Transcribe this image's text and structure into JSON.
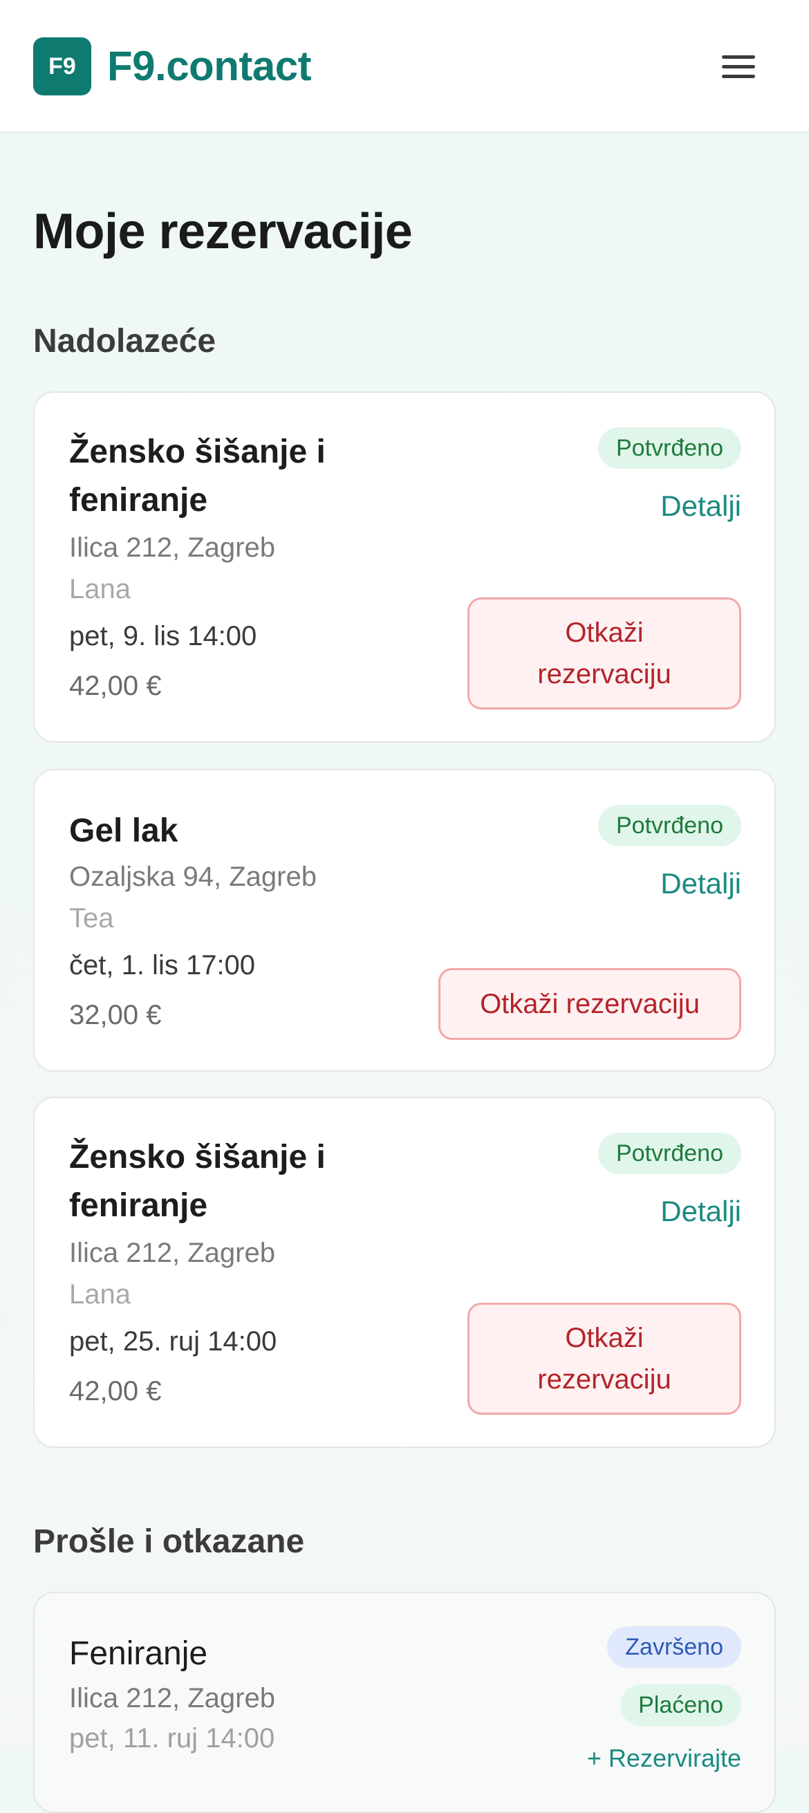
{
  "header": {
    "logo_text": "F9",
    "brand": "F9.contact",
    "menu_icon": "hamburger-icon"
  },
  "page_title": "Moje rezervacije",
  "sections": {
    "upcoming_title": "Nadolazeće",
    "past_title": "Prošle i otkazane"
  },
  "upcoming": [
    {
      "service_line1": "Žensko šišanje i",
      "service_line2": "feniranje",
      "address": "Ilica 212, Zagreb",
      "staff": "Lana",
      "datetime": "pet, 9. lis 14:00",
      "price": "42,00 €",
      "status": "Potvrđeno",
      "details_label": "Detalji",
      "cancel_line1": "Otkaži",
      "cancel_line2": "rezervaciju"
    },
    {
      "service_line1": "Gel lak",
      "address": "Ozaljska 94, Zagreb",
      "staff": "Tea",
      "datetime": "čet, 1. lis 17:00",
      "price": "32,00 €",
      "status": "Potvrđeno",
      "details_label": "Detalji",
      "cancel_label": "Otkaži rezervaciju"
    },
    {
      "service_line1": "Žensko šišanje i",
      "service_line2": "feniranje",
      "address": "Ilica 212, Zagreb",
      "staff": "Lana",
      "datetime": "pet, 25. ruj 14:00",
      "price": "42,00 €",
      "status": "Potvrđeno",
      "details_label": "Detalji",
      "cancel_line1": "Otkaži",
      "cancel_line2": "rezervaciju"
    }
  ],
  "past": [
    {
      "service": "Feniranje",
      "address": "Ilica 212, Zagreb",
      "datetime": "pet, 11. ruj 14:00",
      "status": "Završeno",
      "payment": "Plaćeno",
      "link_partial": "+ Rezervirajte"
    }
  ],
  "colors": {
    "brand": "#0f7a70",
    "confirmed_bg": "#e1f6ea",
    "confirmed_text": "#1e7a3e",
    "cancel_text": "#b4232a",
    "completed_bg": "#dfe9fb"
  }
}
